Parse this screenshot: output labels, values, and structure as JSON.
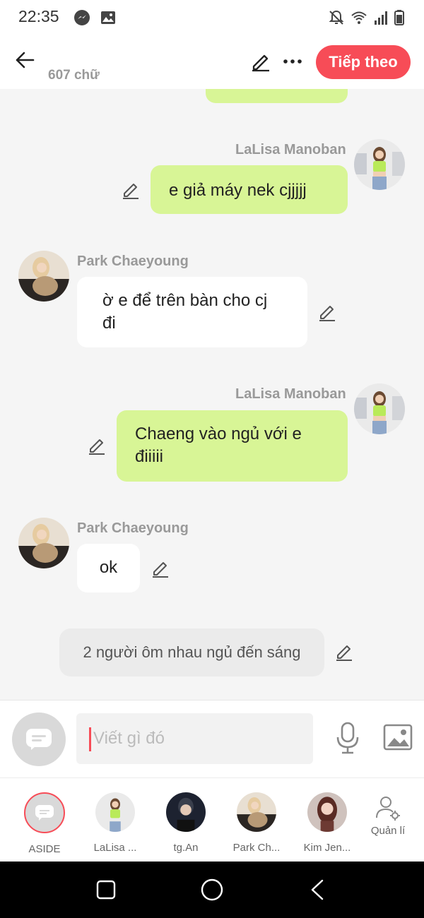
{
  "status_bar": {
    "time": "22:35",
    "icons": [
      "messenger-icon",
      "gallery-icon",
      "mute-icon",
      "wifi-icon",
      "signal-icon",
      "battery-icon"
    ]
  },
  "header": {
    "word_count": "607 chữ",
    "next_label": "Tiếp theo",
    "accent": "#f74c57"
  },
  "chat": {
    "messages": [
      {
        "sender": "LaLisa Manoban",
        "text": "e giả máy nek cjjjjj",
        "side": "right"
      },
      {
        "sender": "Park Chaeyoung",
        "text_line1": "ờ e để trên bàn cho cj",
        "text_line2": "đi",
        "side": "left"
      },
      {
        "sender": "LaLisa Manoban",
        "text_line1": "Chaeng vào ngủ với e",
        "text_line2": "điiiii",
        "side": "right"
      },
      {
        "sender": "Park Chaeyoung",
        "text": "ok",
        "side": "left"
      }
    ],
    "narration": "2 người ôm nhau ngủ đến sáng",
    "bubble_color_right": "#d8f596",
    "bubble_color_left": "#ffffff"
  },
  "input": {
    "placeholder": "Viết gì đó"
  },
  "characters": [
    {
      "label": "ASIDE",
      "icon": "aside-chat-icon"
    },
    {
      "label": "LaLisa ...",
      "icon": "avatar"
    },
    {
      "label": "tg.An",
      "icon": "avatar"
    },
    {
      "label": "Park Ch...",
      "icon": "avatar"
    },
    {
      "label": "Kim Jen...",
      "icon": "avatar"
    },
    {
      "label": "Quản lí",
      "icon": "manage-users-icon"
    }
  ],
  "navbar": {
    "icons": [
      "recents-icon",
      "home-icon",
      "back-icon"
    ]
  }
}
